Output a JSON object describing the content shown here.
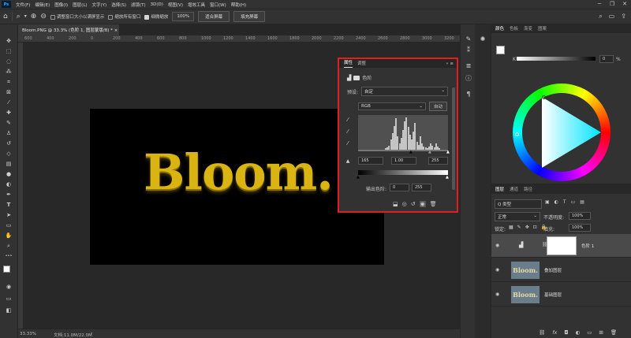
{
  "menu": {
    "logo": "Ps",
    "items": [
      "文件(F)",
      "编辑(E)",
      "图像(I)",
      "图层(L)",
      "文字(Y)",
      "选择(S)",
      "滤镜(T)",
      "3D(D)",
      "视图(V)",
      "增效工具",
      "窗口(W)",
      "帮助(H)"
    ]
  },
  "options": {
    "resize_label": "调整窗口大小以满屏显示",
    "zoom_all_label": "缩放所有窗口",
    "scrubby_label": "细微缩放",
    "zoom_value": "100%",
    "fit_screen": "适合屏幕",
    "fill_screen": "填充屏幕"
  },
  "document": {
    "tab_title": "Bloom.PNG @ 33.3% (色阶 1, 图层蒙版/8) *",
    "artwork_text": "Bloom."
  },
  "ruler": {
    "marks": [
      "600",
      "400",
      "200",
      "0",
      "200",
      "400",
      "600",
      "800",
      "1000",
      "1200",
      "1400",
      "1600",
      "1800",
      "2000",
      "2200",
      "2400",
      "2600",
      "2800",
      "3000",
      "3200"
    ]
  },
  "status": {
    "zoom": "33.33%",
    "doc_info": "文档:11.0M/22.0M"
  },
  "properties": {
    "tab_active": "属性",
    "tab_other": "调整",
    "layer_label": "色阶",
    "preset_label": "预设:",
    "preset_value": "自定",
    "channel": "RGB",
    "auto_button": "自动",
    "input_black": "165",
    "input_gamma": "1.00",
    "input_white": "255",
    "output_label": "输出色阶:",
    "output_black": "0",
    "output_white": "255"
  },
  "color_panel": {
    "tabs": [
      "颜色",
      "色板",
      "渐变",
      "图案"
    ],
    "slider_label": "K",
    "slider_value": "0",
    "slider_unit": "%"
  },
  "layers_panel": {
    "tabs": [
      "图层",
      "通道",
      "路径"
    ],
    "filter_label": "Q 类型",
    "blend_mode": "正常",
    "opacity_label": "不透明度:",
    "opacity_value": "100%",
    "lock_label": "锁定:",
    "fill_label": "填充:",
    "fill_value": "100%",
    "layers": [
      {
        "name": "色阶 1"
      },
      {
        "name": "叠加图层"
      },
      {
        "name": "基础图层"
      }
    ],
    "thumb_text": "Bloom."
  },
  "colors": {
    "accent_red": "#e02020",
    "gold": "#d9b413"
  },
  "histogram": {
    "levels": [
      0.05,
      0.08,
      0.12,
      0.3,
      0.5,
      0.72,
      0.95,
      0.4,
      0.2,
      0.35,
      0.6,
      0.85,
      0.98,
      0.7,
      0.45,
      0.3,
      0.55,
      0.8,
      0.25,
      0.15,
      0.4,
      0.2,
      0.1,
      0.08,
      0.05,
      0.1,
      0.2,
      0.12,
      0.06,
      0.18,
      0.1,
      0.05
    ]
  }
}
